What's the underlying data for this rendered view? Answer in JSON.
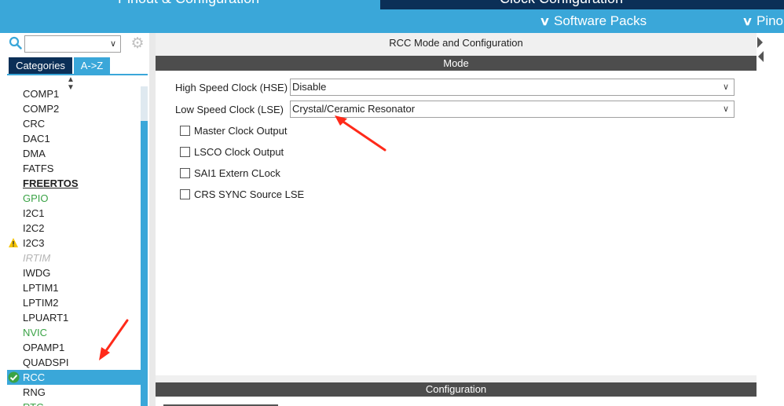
{
  "top_tabs": {
    "pinout_config": "Pinout & Configuration",
    "clock_config": "Clock Configuration"
  },
  "sub_bar": {
    "software_packs": "Software Packs",
    "pinout": "Pino"
  },
  "left_panel": {
    "search": {
      "value": "",
      "icon": "search-icon"
    },
    "settings_icon": "gear-icon",
    "tabs": {
      "categories": "Categories",
      "az": "A->Z"
    },
    "items": [
      {
        "label": "COMP1",
        "style": "normal"
      },
      {
        "label": "COMP2",
        "style": "normal"
      },
      {
        "label": "CRC",
        "style": "normal"
      },
      {
        "label": "DAC1",
        "style": "normal"
      },
      {
        "label": "DMA",
        "style": "normal"
      },
      {
        "label": "FATFS",
        "style": "normal"
      },
      {
        "label": "FREERTOS",
        "style": "bold"
      },
      {
        "label": "GPIO",
        "style": "green"
      },
      {
        "label": "I2C1",
        "style": "normal"
      },
      {
        "label": "I2C2",
        "style": "normal"
      },
      {
        "label": "I2C3",
        "style": "warning"
      },
      {
        "label": "IRTIM",
        "style": "disabled"
      },
      {
        "label": "IWDG",
        "style": "normal"
      },
      {
        "label": "LPTIM1",
        "style": "normal"
      },
      {
        "label": "LPTIM2",
        "style": "normal"
      },
      {
        "label": "LPUART1",
        "style": "normal"
      },
      {
        "label": "NVIC",
        "style": "green"
      },
      {
        "label": "OPAMP1",
        "style": "normal"
      },
      {
        "label": "QUADSPI",
        "style": "normal"
      },
      {
        "label": "RCC",
        "style": "selected"
      },
      {
        "label": "RNG",
        "style": "normal"
      },
      {
        "label": "RTC",
        "style": "green"
      }
    ]
  },
  "main": {
    "title": "RCC Mode and Configuration",
    "mode_header": "Mode",
    "hse": {
      "label": "High Speed Clock (HSE)",
      "value": "Disable"
    },
    "lse": {
      "label": "Low Speed Clock (LSE)",
      "value": "Crystal/Ceramic Resonator"
    },
    "checkboxes": [
      {
        "label": "Master Clock Output",
        "checked": false
      },
      {
        "label": "LSCO Clock Output",
        "checked": false
      },
      {
        "label": "SAI1 Extern CLock",
        "checked": false
      },
      {
        "label": "CRS SYNC Source LSE",
        "checked": false
      }
    ],
    "config_header": "Configuration"
  },
  "colors": {
    "accent": "#3aa7d9",
    "dark_navy": "#0b2f57",
    "header_bar": "#4d4d4d",
    "annotation_arrow": "#ff2a1a",
    "green_item": "#3aa346"
  }
}
